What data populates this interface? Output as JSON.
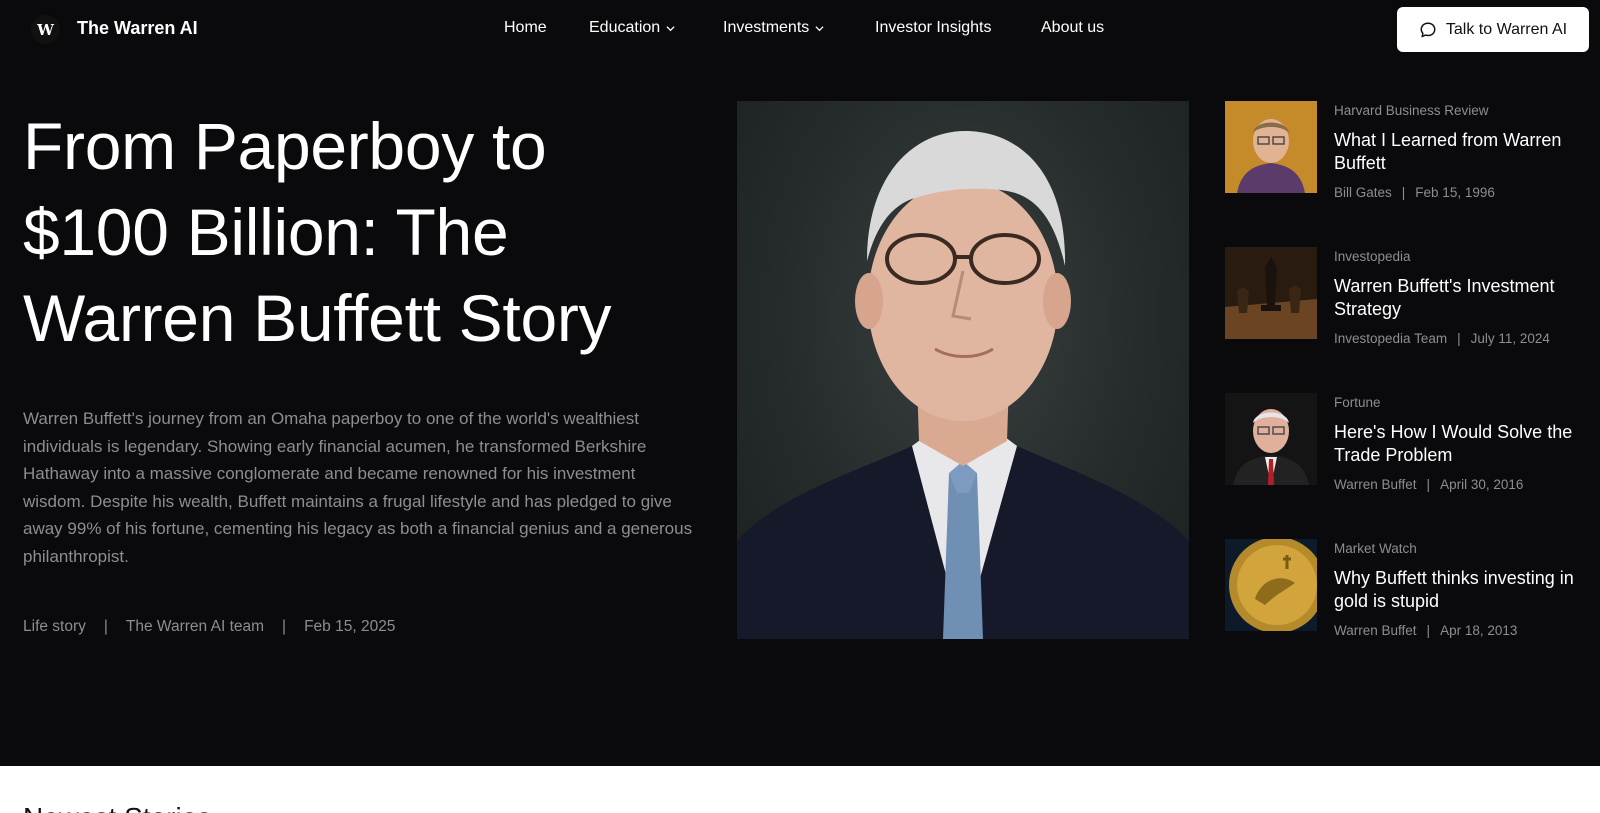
{
  "header": {
    "brand": "The Warren AI",
    "logo_letter": "W",
    "nav": [
      {
        "label": "Home"
      },
      {
        "label": "Education"
      },
      {
        "label": "Investments"
      },
      {
        "label": "Investor Insights"
      },
      {
        "label": "About us"
      }
    ],
    "cta_label": "Talk to Warren AI"
  },
  "hero": {
    "title": "From Paperboy to $100 Billion: The Warren Buffett Story",
    "description": "Warren Buffett's journey from an Omaha paperboy to one of the world's wealthiest individuals is legendary. Showing early financial acumen, he transformed Berkshire Hathaway into a massive conglomerate and became renowned for his investment wisdom. Despite his wealth, Buffett maintains a frugal lifestyle and has pledged to give away 99% of his fortune, cementing his legacy as both a financial genius and a generous philanthropist.",
    "category": "Life story",
    "author": "The Warren AI team",
    "date": "Feb 15, 2025",
    "separator": "|"
  },
  "side_articles": [
    {
      "source": "Harvard Business Review",
      "title": "What I Learned from Warren Buffett",
      "author": "Bill Gates",
      "date": "Feb 15, 1996"
    },
    {
      "source": "Investopedia",
      "title": "Warren Buffett's Investment Strategy",
      "author": "Investopedia Team",
      "date": "July 11, 2024"
    },
    {
      "source": "Fortune",
      "title": "Here's How I Would Solve the Trade Problem",
      "author": "Warren Buffet",
      "date": "April 30, 2016"
    },
    {
      "source": "Market Watch",
      "title": "Why Buffett thinks investing in gold is stupid",
      "author": "Warren Buffet",
      "date": "Apr 18, 2013"
    }
  ],
  "bottom": {
    "section_title": "Newest Stories"
  },
  "colors": {
    "background": "#0a0a0c",
    "muted_text": "#8d8d92",
    "button_bg": "#ffffff"
  }
}
